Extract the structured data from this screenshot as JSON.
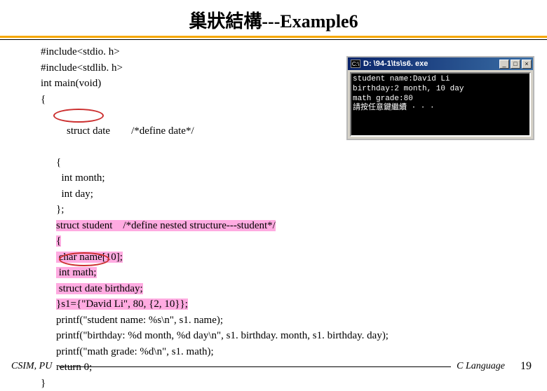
{
  "title": "巢狀結構---Example6",
  "code": {
    "l1": "#include<stdio. h>",
    "l2": "#include<stdlib. h>",
    "l3": "int main(void)",
    "l4": "{",
    "l5a": "struct date",
    "l5b": "        /*define date*/",
    "l6": "{",
    "l7": "  int month;",
    "l8": "  int day;",
    "l9": "};",
    "l10a": "struct student    /*define nested structure---student*/",
    "l11a": "{",
    "l12a": " char name[10];",
    "l13a": " int math;",
    "l14a_pre": " ",
    "l14a": "struct date",
    "l14b": " birthday;",
    "l15a": "}s1={\"David Li\", 80, {2, 10}};",
    "l16": "printf(\"student name: %s\\n\", s1. name);",
    "l17": "printf(\"birthday: %d month, %d day\\n\", s1. birthday. month, s1. birthday. day);",
    "l18": "printf(\"math grade: %d\\n\", s1. math);",
    "l19": "return 0;",
    "l20": "}"
  },
  "console": {
    "icon_text": "C:\\",
    "title": "D: \\94-1\\ts\\s6. exe",
    "buttons": {
      "min": "_",
      "max": "□",
      "close": "×"
    },
    "out1": "student name:David Li",
    "out2": "birthday:2 month, 10 day",
    "out3": "math grade:80",
    "out4": "請按任意鍵繼續 · · ·"
  },
  "footer": {
    "left": "CSIM, PU",
    "lang": "C Language",
    "page": "19"
  }
}
